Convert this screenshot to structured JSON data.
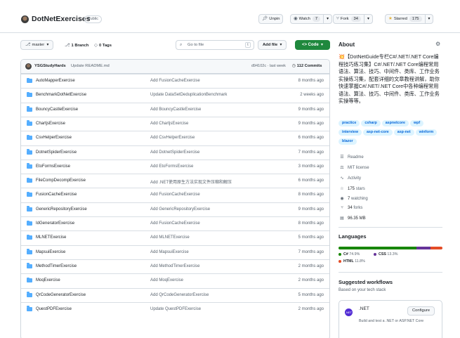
{
  "header": {
    "repo_name": "DotNetExercises",
    "visibility": "Public",
    "unpin_label": "Unpin",
    "watch_label": "Watch",
    "watch_count": "7",
    "fork_label": "Fork",
    "fork_count": "34",
    "starred_label": "Starred",
    "star_count": "175"
  },
  "branchbar": {
    "branch": "master",
    "branches": "1 Branch",
    "tags": "0 Tags",
    "search_placeholder": "Go to file",
    "search_key": "t",
    "add_file": "Add file",
    "code": "Code"
  },
  "commit": {
    "author": "YSGStudyHards",
    "message": "Update README.md",
    "hash": "d94102c · last week",
    "count": "112 Commits"
  },
  "files": [
    {
      "name": "AutoMapperExercise",
      "message": "Add FusionCacheExercise",
      "time": "8 months ago"
    },
    {
      "name": "BenchmarkDotNetExercise",
      "message": "Update DataSetDeduplicationBenchmark",
      "time": "2 weeks ago"
    },
    {
      "name": "BouncyCastleExercise",
      "message": "Add BouncyCastleExercise",
      "time": "9 months ago"
    },
    {
      "name": "ChartjsExercise",
      "message": "Add ChartjsExercise",
      "time": "9 months ago"
    },
    {
      "name": "CsvHelperExercise",
      "message": "Add CsvHelperExercise",
      "time": "6 months ago"
    },
    {
      "name": "DotnetSpiderExercise",
      "message": "Add DotnetSpiderExercise",
      "time": "7 months ago"
    },
    {
      "name": "EtoFormsExercise",
      "message": "Add EtoFormsExercise",
      "time": "3 months ago"
    },
    {
      "name": "FileCompDecompExercise",
      "message": "Add .NET使用原生方法实现文件压缩和解压",
      "time": "6 months ago"
    },
    {
      "name": "FusionCacheExercise",
      "message": "Add FusionCacheExercise",
      "time": "8 months ago"
    },
    {
      "name": "GenericRepositoryExercise",
      "message": "Add GenericRepositoryExercise",
      "time": "9 months ago"
    },
    {
      "name": "IdGeneratorExercise",
      "message": "Add FusionCacheExercise",
      "time": "8 months ago"
    },
    {
      "name": "MLNETExercise",
      "message": "Add MLNETExercise",
      "time": "5 months ago"
    },
    {
      "name": "MapsuiExercise",
      "message": "Add MapsuiExercise",
      "time": "7 months ago"
    },
    {
      "name": "MethodTimerExercise",
      "message": "Add MethodTimerExercise",
      "time": "2 months ago"
    },
    {
      "name": "MoqExercise",
      "message": "Add MoqExercise",
      "time": "2 months ago"
    },
    {
      "name": "QrCodeGeneratorExercise",
      "message": "Add QrCodeGeneratorExercise",
      "time": "5 months ago"
    },
    {
      "name": "QuestPDFExercise",
      "message": "Update QuestPDFExercise",
      "time": "2 months ago"
    }
  ],
  "about": {
    "title": "About",
    "description": "💥【DotNetGuide专栏C#/.NET/.NET Core编程技巧练习集】C#/.NET/.NET Core编程常用语法、算法、技巧、中间件、类库、工作业务实操练习集，配套详细的文章教程讲解，助你快速掌握C#/.NET/.NET Core中各种编程常用语法、算法、技巧、中间件、类库、工作业务实操等等。",
    "topics": [
      "practice",
      "csharp",
      "aspnetcore",
      "wpf",
      "interview",
      "asp-net-core",
      "asp-net",
      "winform",
      "blazor"
    ],
    "readme": "Readme",
    "license": "MIT license",
    "activity": "Activity",
    "stars_num": "175",
    "stars_label": "stars",
    "watching_num": "7",
    "watching_label": "watching",
    "forks_num": "34",
    "forks_label": "forks",
    "size": "96.35 MB"
  },
  "languages": {
    "title": "Languages",
    "items": [
      {
        "name": "C#",
        "percent": "74.9%",
        "color": "#178600",
        "share": 74.9
      },
      {
        "name": "CSS",
        "percent": "13.3%",
        "color": "#663399",
        "share": 13.3
      },
      {
        "name": "HTML",
        "percent": "11.8%",
        "color": "#e34c26",
        "share": 11.8
      }
    ]
  },
  "workflows": {
    "title": "Suggested workflows",
    "subtitle": "Based on your tech stack",
    "name": ".NET",
    "configure": "Configure",
    "description": "Build and test a .NET or ASP.NET Core"
  },
  "colors": {
    "accent": "#0969da",
    "code_button": "#1f883d",
    "folder": "#54aeff"
  }
}
